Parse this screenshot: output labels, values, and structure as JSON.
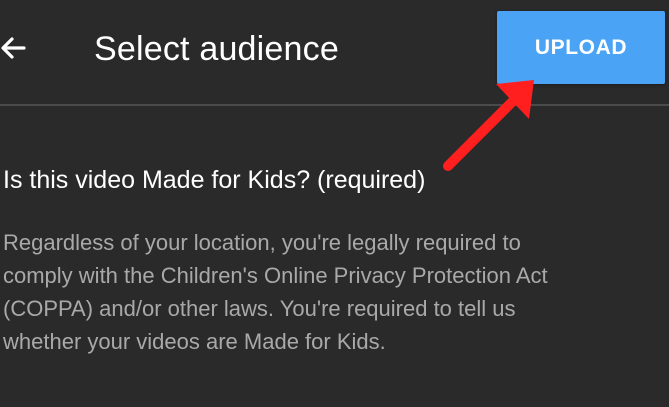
{
  "screen": {
    "title": "Select audience",
    "upload_label": "UPLOAD",
    "question": "Is this video Made for Kids? (required)",
    "description": "Regardless of your location, you're legally required to\ncomply with the Children's Online Privacy Protection Act\n(COPPA) and/or other laws. You're required to tell us\nwhether your videos are Made for Kids.",
    "icons": {
      "back": "back-arrow-icon",
      "callout": "red-pointer-arrow"
    },
    "colors": {
      "background": "#2a2a2a",
      "upload_button": "#4aa3f5",
      "callout_arrow": "#ff1f1f",
      "secondary_text": "#a9a9a9"
    }
  }
}
